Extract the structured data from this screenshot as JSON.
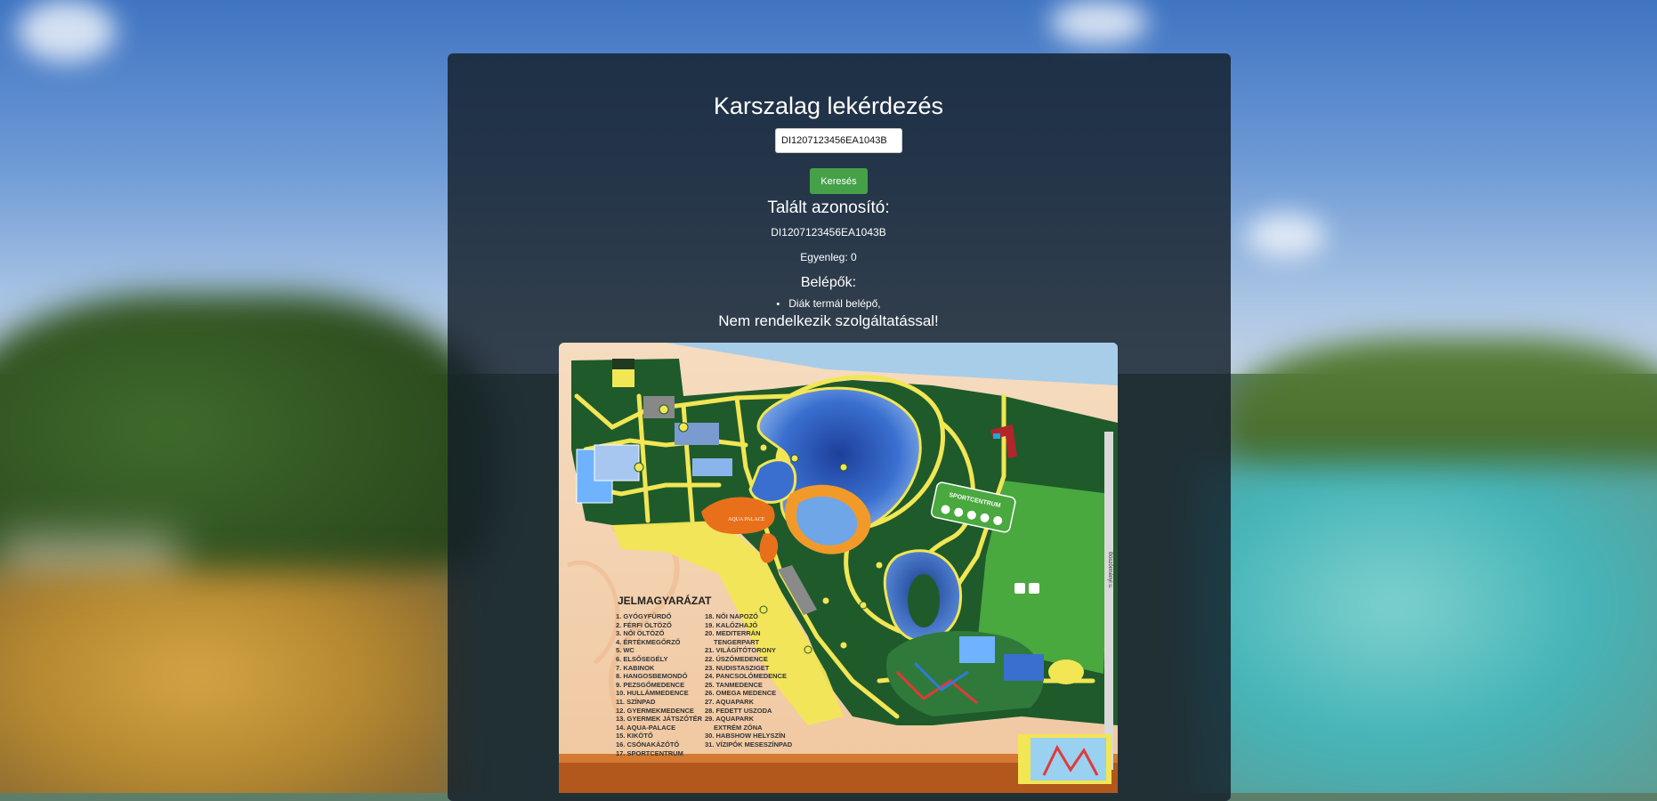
{
  "page": {
    "title": "Karszalag lekérdezés"
  },
  "search": {
    "value": "DI1207123456EA1043B",
    "button_label": "Keresés"
  },
  "result": {
    "found_heading": "Talált azonosító:",
    "found_id": "DI1207123456EA1043B",
    "balance": "Egyenleg: 0",
    "entries_heading": "Belépők:",
    "entries": [
      "Diák termál belépő,"
    ],
    "no_service": "Nem rendelkezik szolgáltatással!"
  },
  "map": {
    "legend_title": "JELMAGYARÁZAT",
    "legend_col1": [
      "1. GYÓGYFÜRDŐ",
      "2. FÉRFI ÖLTÖZŐ",
      "3. NŐI ÖLTÖZŐ",
      "4. ÉRTÉKMEGŐRZŐ",
      "5. WC",
      "6. ELSŐSEGÉLY",
      "7. KABINOK",
      "8. HANGOSBEMONDÓ",
      "9. PEZSGŐMEDENCE",
      "10. HULLÁMMEDENCE",
      "11. SZÍNPAD",
      "12. GYERMEKMEDENCE",
      "13. GYERMEK JÁTSZÓTÉR",
      "14. AQUA-PALACE",
      "15. KIKÖTŐ",
      "16. CSÓNAKÁZÓTÓ",
      "17. SPORTCENTRUM"
    ],
    "legend_col2": [
      "18. NŐI NAPOZÓ",
      "19. KALÓZHAJÓ",
      "20. MEDITERRÁN",
      "TENGERPART",
      "21. VILÁGÍTÓTORONY",
      "22. ÚSZÓMEDENCE",
      "23. NUDISTASZIGET",
      "24. PANCSOLÓMEDENCE",
      "25. TANMEDENCE",
      "26. OMEGA MEDENCE",
      "27. AQUAPARK",
      "28. FEDETT USZODA",
      "29. AQUAPARK",
      "EXTRÉM ZÓNA",
      "30. HABSHOW HELYSZÍN",
      "31. VÍZIPÓK MESESZÍNPAD"
    ],
    "sport_label": "SPORTCENTRUM",
    "aqua_palace_label": "AQUA PALACE",
    "street_label": "Böszörményi u.",
    "colors": {
      "grass": "#1f5a2b",
      "path": "#f2e654",
      "water": "#3a6fd0",
      "sand": "#f3cfae",
      "sky": "#a8cde8"
    }
  }
}
